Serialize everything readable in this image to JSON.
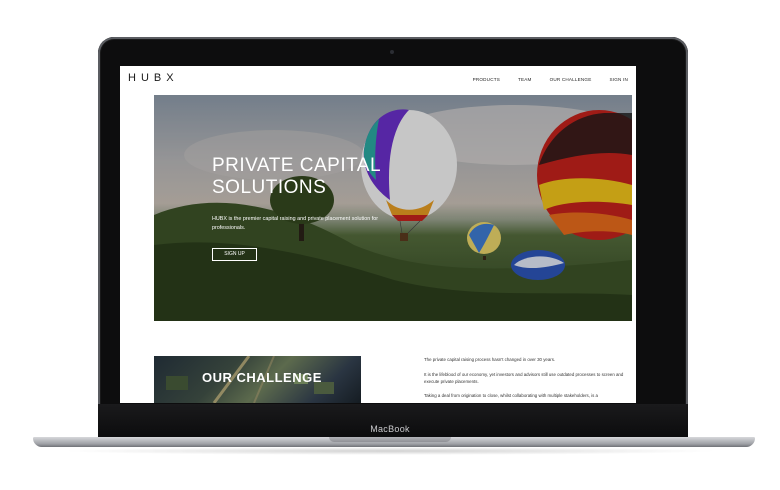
{
  "device": {
    "label": "MacBook"
  },
  "site": {
    "logo": "HUBX",
    "nav": [
      "PRODUCTS",
      "TEAM",
      "OUR CHALLENGE",
      "SIGN IN"
    ],
    "hero": {
      "title_line1": "PRIVATE CAPITAL",
      "title_line2": "SOLUTIONS",
      "subtitle": "HUBX is the premier capital raising and private placement solution for professionals.",
      "button": "SIGN UP"
    },
    "challenge": {
      "title": "OUR CHALLENGE",
      "paragraphs": [
        "The private capital raising process hasn't changed in over 30 years.",
        "It is the lifeblood of our economy, yet investors and advisors still use outdated processes to screen and execute private placements.",
        "Taking a deal from origination to close, whilst collaborating with multiple stakeholders, is a"
      ]
    }
  },
  "colors": {
    "lid": "#0d0d0e",
    "accent_red": "#c2221b",
    "accent_purple": "#6a2fc9",
    "accent_teal": "#2aa8a0"
  }
}
